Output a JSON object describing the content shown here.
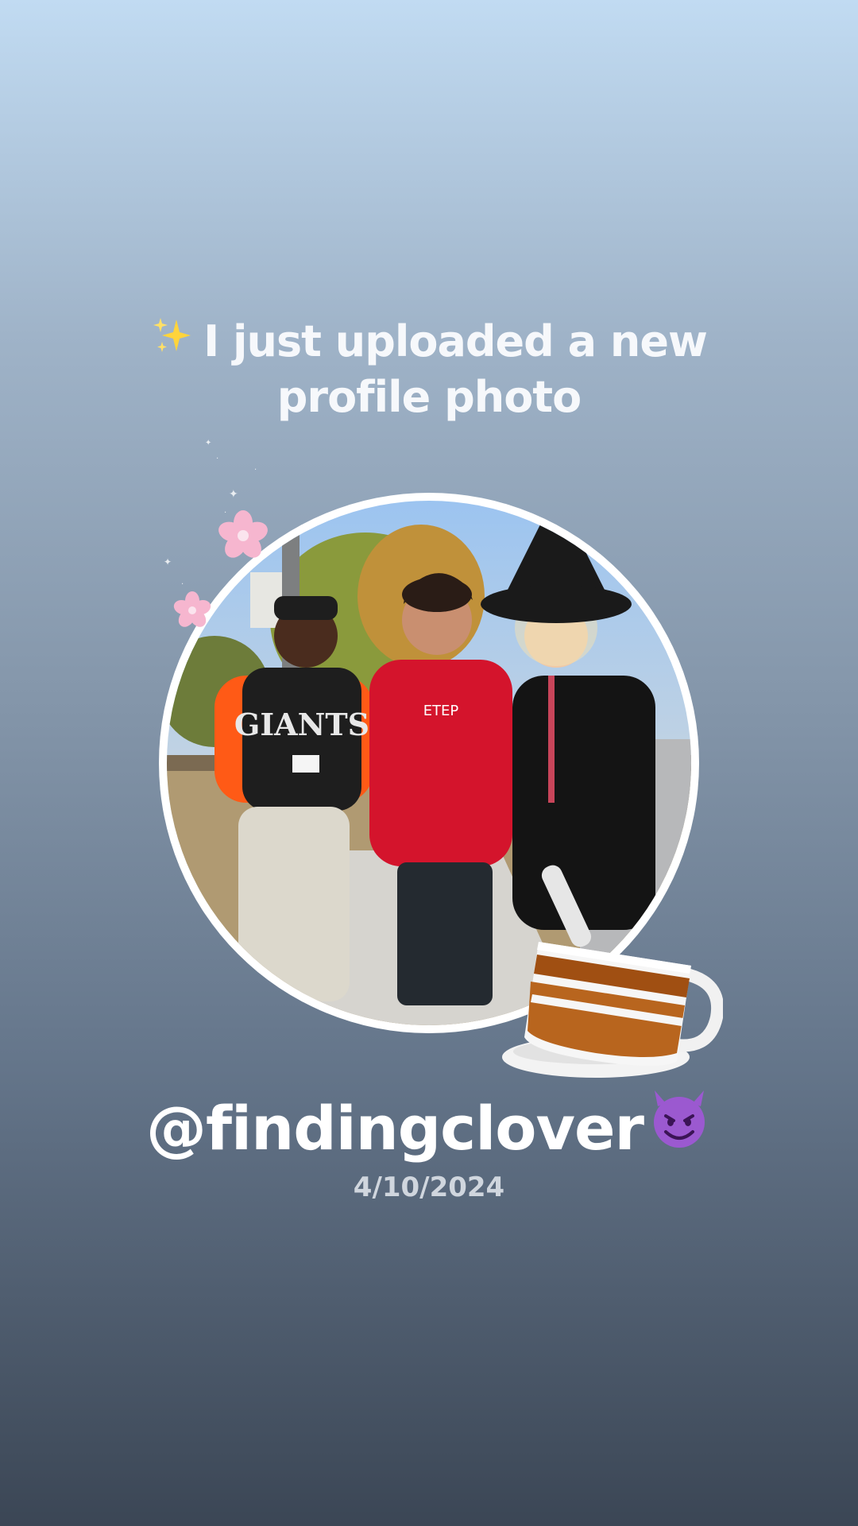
{
  "story": {
    "headline_icon": "sparkles-icon",
    "headline": "I just uploaded a new profile photo",
    "username": "@findingclover",
    "username_icon": "smiling-devil-icon",
    "date": "4/10/2024",
    "decor_icons": [
      "cherry-blossom-icon",
      "cherry-blossom-icon",
      "coffee-cup-icon"
    ]
  },
  "photo": {
    "jersey_text": "GIANTS",
    "hoodie_text": "ETEP"
  },
  "colors": {
    "gradient_top": "#c1dbf2",
    "gradient_bottom": "#3b4655",
    "text": "#ffffff",
    "date_text": "#d0d6de",
    "ring": "#ffffff",
    "blossom": "#f6b6cf",
    "cup_stripe": "#a04f12"
  }
}
